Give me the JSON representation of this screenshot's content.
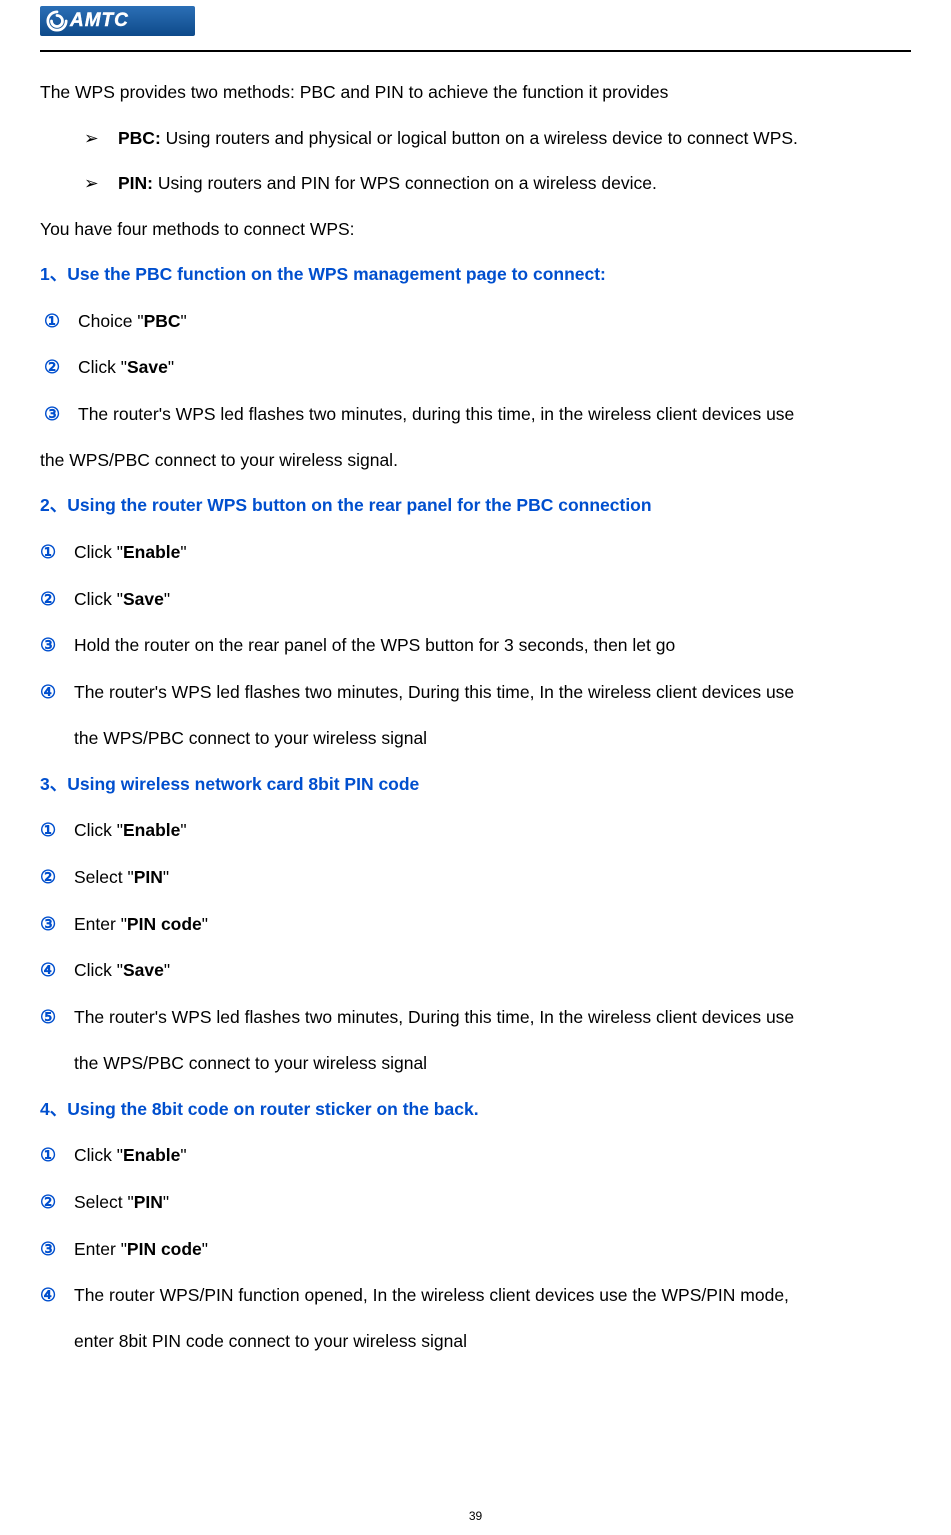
{
  "logo": {
    "text": "AMTC"
  },
  "intro": "The WPS provides two methods: PBC and PIN to achieve the function it provides",
  "bullets": {
    "mark": "➢",
    "pbc": {
      "label": "PBC:",
      "text": " Using routers and physical or logical button on a wireless device to connect WPS."
    },
    "pin": {
      "label": "PIN:",
      "text": " Using routers and PIN for WPS connection on a wireless device."
    }
  },
  "methods_intro": "You have four methods to connect WPS:",
  "section1": {
    "heading": "1、Use the PBC function on the WPS management page to connect:",
    "steps": {
      "n1": "①",
      "n2": "②",
      "n3": "③",
      "s1_pre": "Choice \"",
      "s1_bold": "PBC",
      "s1_post": "\"",
      "s2_pre": "Click \"",
      "s2_bold": "Save",
      "s2_post": "\"",
      "s3": "The router's WPS led flashes two minutes, during this time, in the wireless client devices use",
      "s3b": "the WPS/PBC connect to your wireless signal."
    }
  },
  "section2": {
    "heading": "2、Using the router WPS button on the rear panel for the PBC connection",
    "steps": {
      "n1": "①",
      "n2": "②",
      "n3": "③",
      "n4": "④",
      "s1_pre": "Click \"",
      "s1_bold": "Enable",
      "s1_post": "\"",
      "s2_pre": "Click \"",
      "s2_bold": "Save",
      "s2_post": "\"",
      "s3": "Hold the router on the rear panel of the WPS button for 3 seconds, then let go",
      "s4": "The router's WPS led flashes two minutes, During this time, In the wireless client devices use",
      "s4b": "the WPS/PBC connect to your wireless signal"
    }
  },
  "section3": {
    "heading": "3、Using wireless network card 8bit PIN code",
    "steps": {
      "n1": "①",
      "n2": "②",
      "n3": "③",
      "n4": "④",
      "n5": "⑤",
      "s1_pre": "Click \"",
      "s1_bold": "Enable",
      "s1_post": "\"",
      "s2_pre": "Select \"",
      "s2_bold": "PIN",
      "s2_post": "\"",
      "s3_pre": "Enter \"",
      "s3_bold": "PIN code",
      "s3_post": "\"",
      "s4_pre": "Click \"",
      "s4_bold": "Save",
      "s4_post": "\"",
      "s5": "The router's WPS led flashes two minutes, During this time, In the wireless client devices use",
      "s5b": "the WPS/PBC connect to your wireless signal"
    }
  },
  "section4": {
    "heading": "4、Using the 8bit code on router sticker on the back.",
    "steps": {
      "n1": "①",
      "n2": "②",
      "n3": "③",
      "n4": "④",
      "s1_pre": "Click \"",
      "s1_bold": "Enable",
      "s1_post": "\"",
      "s2_pre": "Select \"",
      "s2_bold": "PIN",
      "s2_post": "\"",
      "s3_pre": "Enter \"",
      "s3_bold": "PIN code",
      "s3_post": "\"",
      "s4": "The router WPS/PIN function opened, In the wireless client devices use the WPS/PIN mode,",
      "s4b": "enter 8bit PIN code connect to your wireless signal"
    }
  },
  "page_number": "39"
}
